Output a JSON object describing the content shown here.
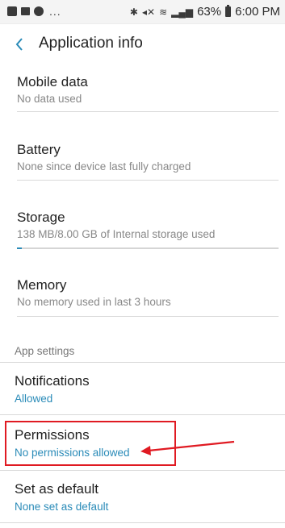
{
  "status_bar": {
    "left_dots": "...",
    "battery_percent": "63%",
    "time": "6:00 PM"
  },
  "app_bar": {
    "title": "Application info"
  },
  "items": {
    "mobile_data": {
      "title": "Mobile data",
      "subtitle": "No data used"
    },
    "battery": {
      "title": "Battery",
      "subtitle": "None since device last fully charged"
    },
    "storage": {
      "title": "Storage",
      "subtitle": "138 MB/8.00 GB of Internal storage used",
      "usage_fraction": 0.017
    },
    "memory": {
      "title": "Memory",
      "subtitle": "No memory used in last 3 hours"
    }
  },
  "section": {
    "label": "App settings"
  },
  "settings": {
    "notifications": {
      "title": "Notifications",
      "subtitle": "Allowed"
    },
    "permissions": {
      "title": "Permissions",
      "subtitle": "No permissions allowed"
    },
    "set_as_default": {
      "title": "Set as default",
      "subtitle": "None set as default"
    }
  },
  "colors": {
    "accent": "#2a8bb8",
    "annotation": "#e01a22"
  },
  "icons": [
    "gallery-icon",
    "message-icon",
    "sync-icon",
    "bluetooth-icon",
    "mute-icon",
    "wifi-icon",
    "signal-icon",
    "battery-icon",
    "back-arrow-icon",
    "annotation-arrow-icon"
  ]
}
